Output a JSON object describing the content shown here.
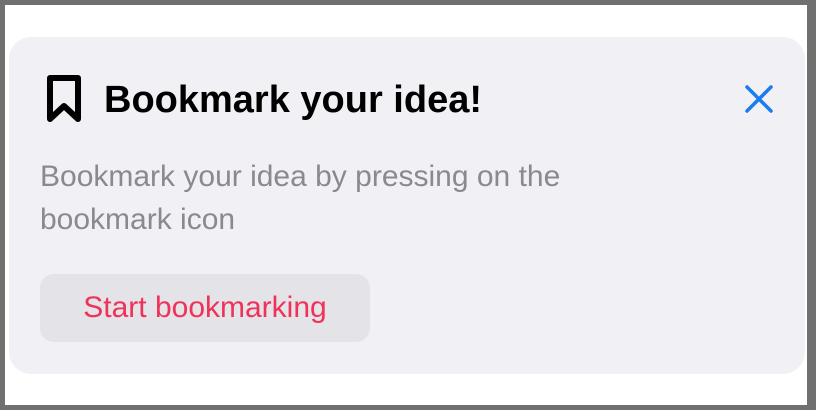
{
  "card": {
    "icon": "bookmark-icon",
    "title": "Bookmark your idea!",
    "close_icon": "close-icon",
    "body": "Bookmark your idea by pressing on the bookmark icon",
    "button_label": "Start bookmarking"
  },
  "colors": {
    "card_background": "#f1f0f5",
    "button_background": "#e3e3e8",
    "button_text": "#f0325a",
    "close_icon": "#1a7cf0",
    "body_text": "#8a8a8e",
    "title_text": "#000000"
  }
}
